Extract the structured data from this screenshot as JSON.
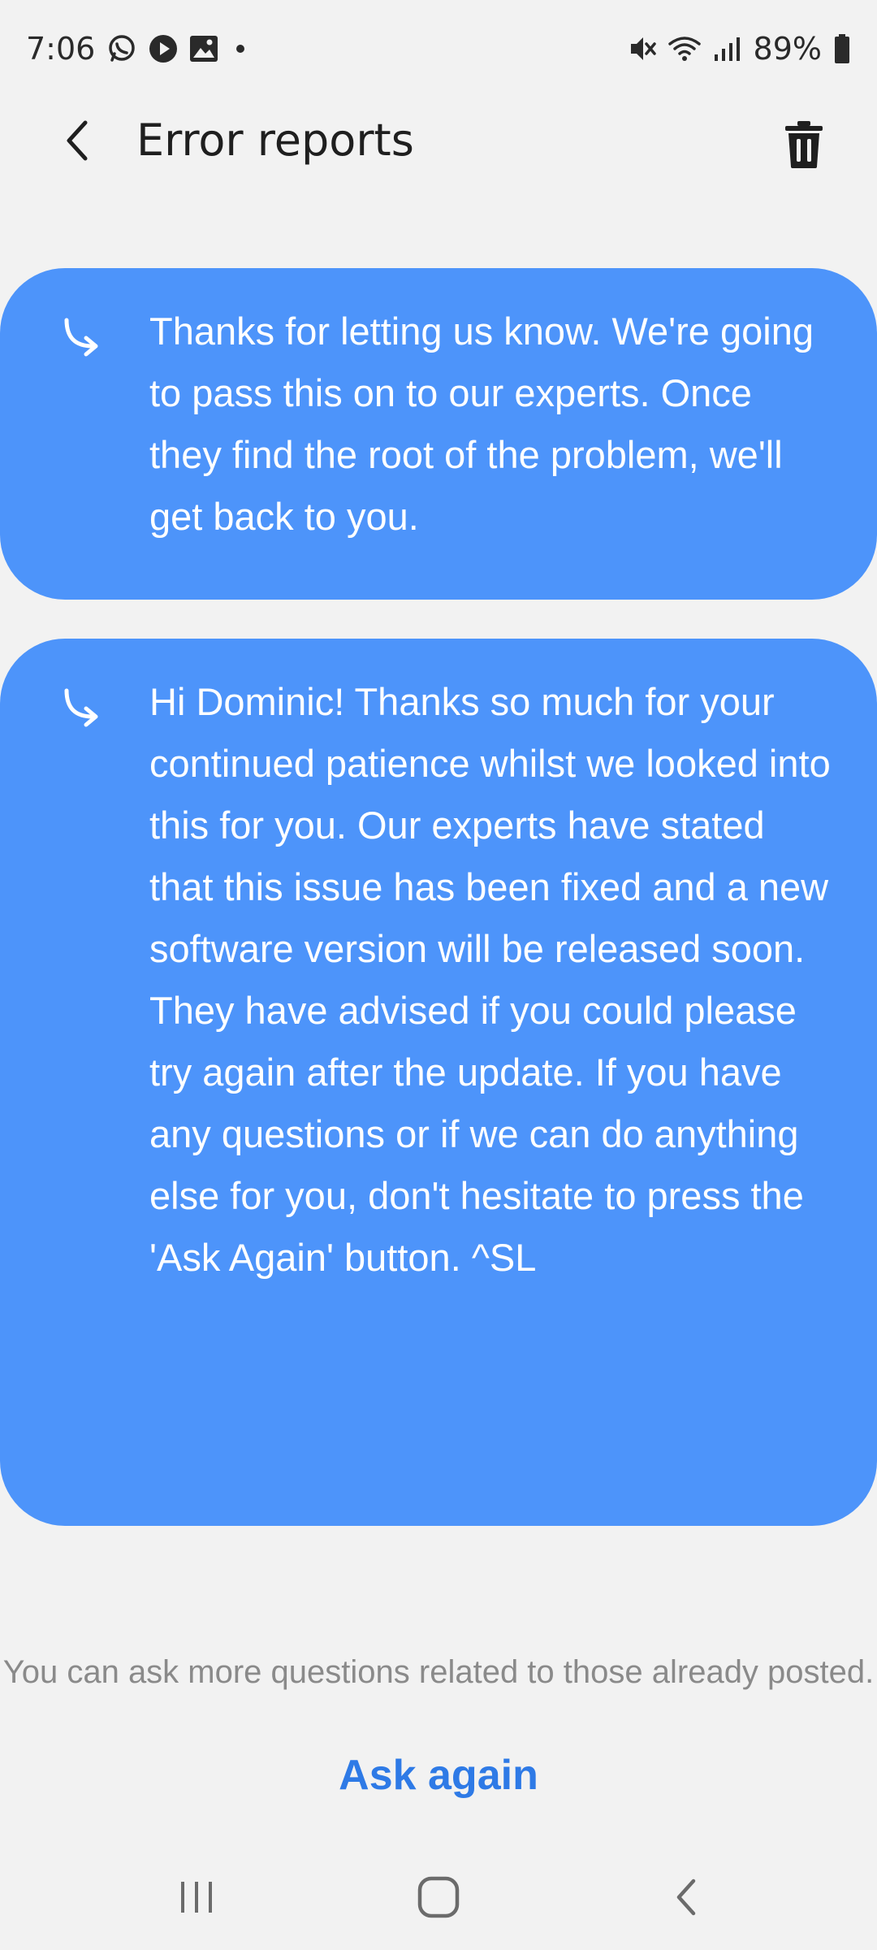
{
  "status_bar": {
    "time": "7:06",
    "battery": "89%",
    "left_icons": [
      "whatsapp-icon",
      "play-icon",
      "gallery-icon",
      "notification-dot-icon"
    ],
    "right_icons": [
      "mute-icon",
      "wifi-icon",
      "signal-icon",
      "battery-icon"
    ]
  },
  "header": {
    "title": "Error reports"
  },
  "messages": [
    {
      "text": "Thanks for letting us know. We're going to pass this on to our experts. Once they find the root of the problem, we'll get back to you."
    },
    {
      "text": "Hi Dominic! Thanks so much for your continued patience whilst we looked into this for you. Our experts have stated that this issue has been fixed and a new software version will be released soon. They have advised if you could please try again after the update. If you have any questions or if we can do anything else for you, don't hesitate to press the 'Ask Again' button. ^SL"
    }
  ],
  "footer": {
    "hint": "You can ask more questions related to those already posted.",
    "ask_again_label": "Ask again"
  },
  "colors": {
    "background": "#f2f2f2",
    "card": "#4d94fa",
    "accent": "#2e7ae6"
  }
}
